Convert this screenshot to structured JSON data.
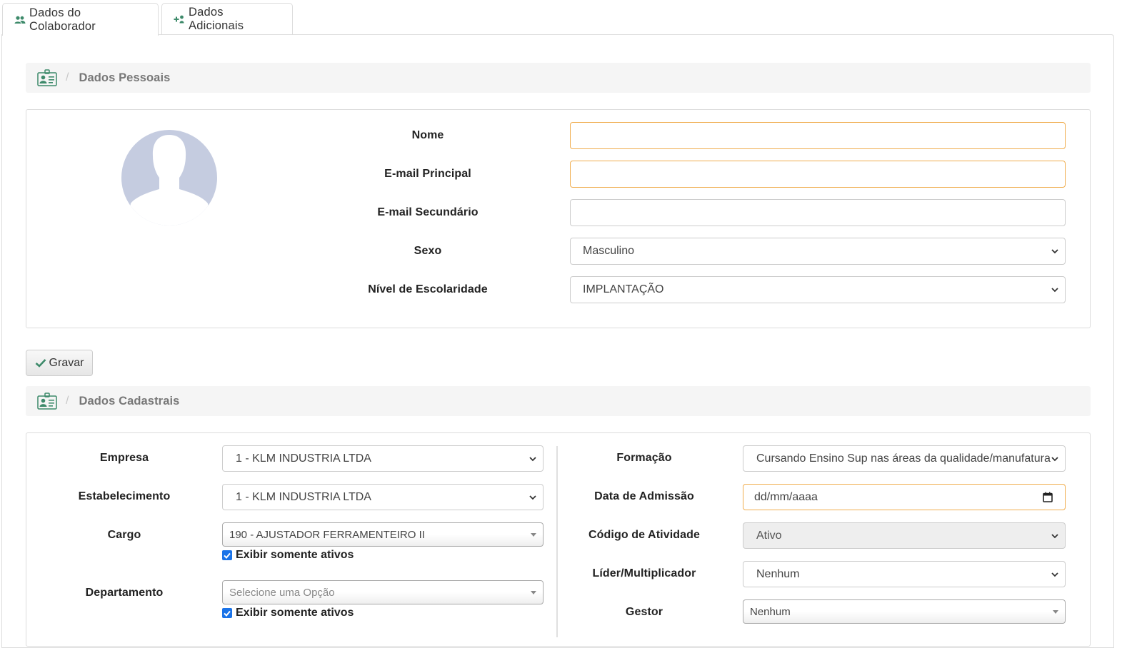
{
  "tabs": [
    {
      "label": "Dados do Colaborador",
      "icon": "users-icon",
      "active": true
    },
    {
      "label": "Dados Adicionais",
      "icon": "user-plus-icon",
      "active": false
    }
  ],
  "sections": {
    "pessoais": {
      "title": "Dados Pessoais",
      "icon": "id-card-icon"
    },
    "cadastrais": {
      "title": "Dados Cadastrais",
      "icon": "id-card-icon"
    }
  },
  "pessoais": {
    "nome": {
      "label": "Nome",
      "value": ""
    },
    "email_principal": {
      "label": "E-mail Principal",
      "value": ""
    },
    "email_secundario": {
      "label": "E-mail Secundário",
      "value": ""
    },
    "sexo": {
      "label": "Sexo",
      "value": "Masculino"
    },
    "escolaridade": {
      "label": "Nível de Escolaridade",
      "value": "IMPLANTAÇÃO"
    }
  },
  "gravar_label": "Gravar",
  "cadastrais": {
    "empresa": {
      "label": "Empresa",
      "value": "1 - KLM INDUSTRIA LTDA"
    },
    "estabelecimento": {
      "label": "Estabelecimento",
      "value": "1 - KLM INDUSTRIA LTDA"
    },
    "cargo": {
      "label": "Cargo",
      "value": "190 - AJUSTADOR FERRAMENTEIRO II",
      "checkbox": "Exibir somente ativos"
    },
    "departamento": {
      "label": "Departamento",
      "placeholder": "Selecione uma Opção",
      "checkbox": "Exibir somente ativos"
    },
    "formacao": {
      "label": "Formação",
      "value": "Cursando Ensino Sup nas áreas da qualidade/manufatura"
    },
    "data_admissao": {
      "label": "Data de Admissão",
      "placeholder": "dd/mm/aaaa"
    },
    "codigo_atividade": {
      "label": "Código de Atividade",
      "value": "Ativo"
    },
    "lider": {
      "label": "Líder/Multiplicador",
      "value": "Nenhum"
    },
    "gestor": {
      "label": "Gestor",
      "value": "Nenhum"
    }
  },
  "colors": {
    "accent_green": "#3d8a6a",
    "warning_border": "#f0ad4e",
    "checkbox_blue": "#1a73e8",
    "avatar": "#c5cce0"
  }
}
